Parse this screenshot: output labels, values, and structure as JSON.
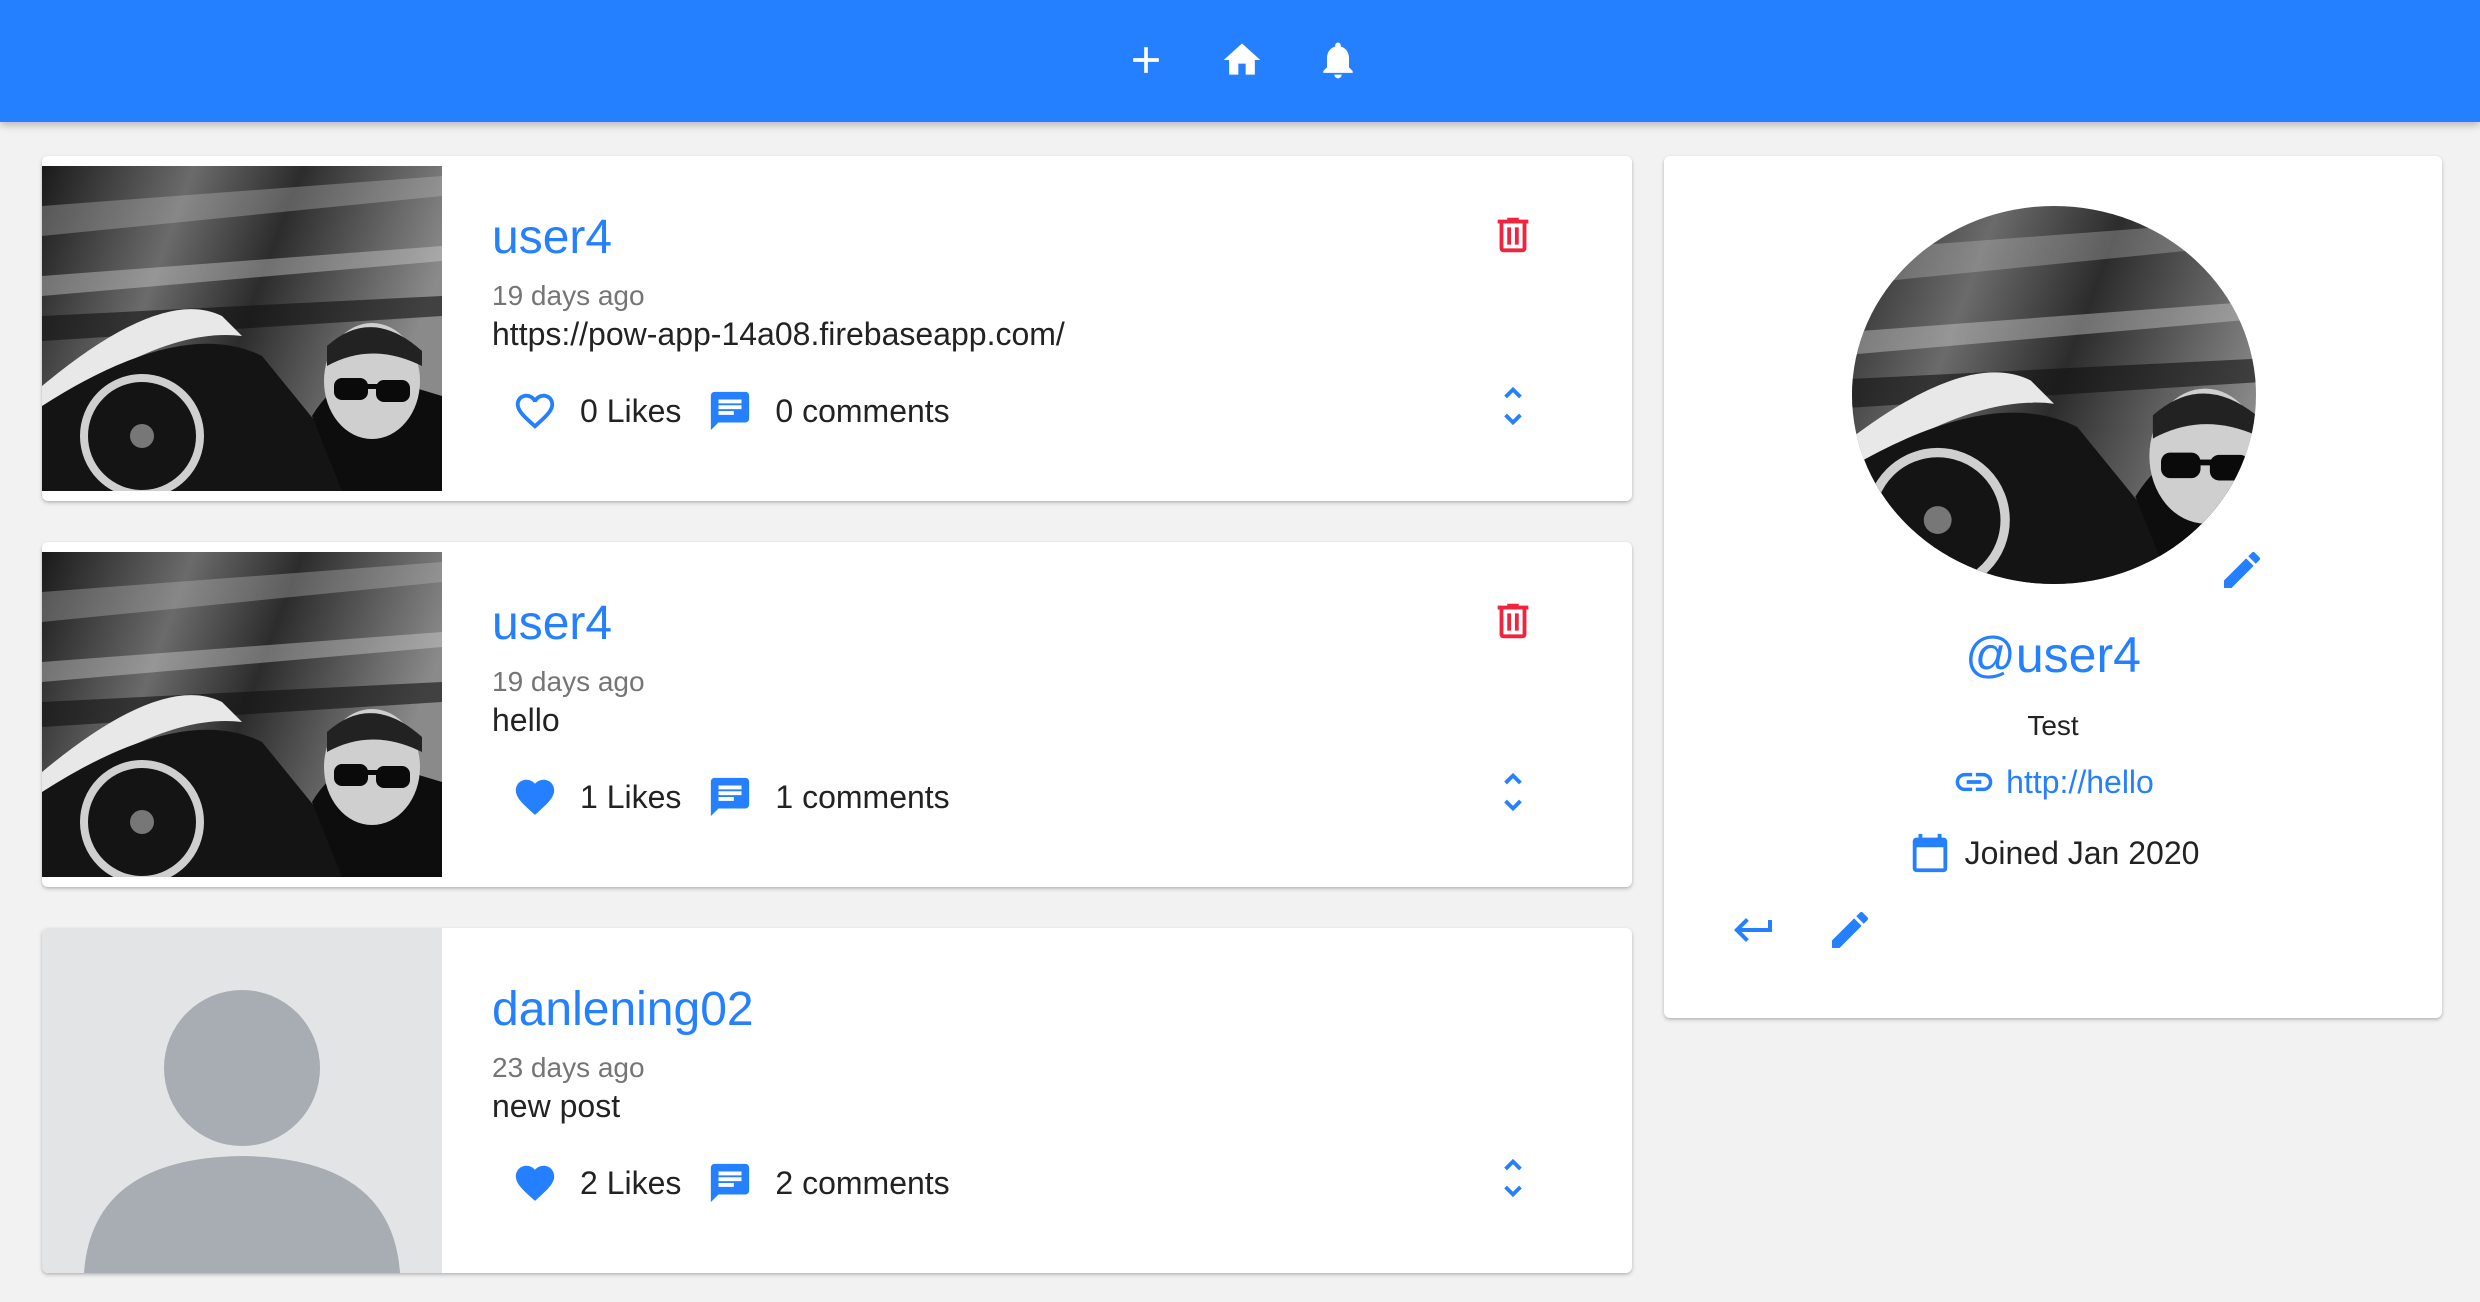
{
  "topbar": {
    "icons": [
      "add-icon",
      "home-icon",
      "notifications-icon"
    ],
    "color": "#2580ff"
  },
  "posts": [
    {
      "username": "user4",
      "time": "19 days ago",
      "body": "https://pow-app-14a08.firebaseapp.com/",
      "likes": "0 Likes",
      "comments": "0 comments",
      "liked": false,
      "image": "driver-photo",
      "deletable": true
    },
    {
      "username": "user4",
      "time": "19 days ago",
      "body": "hello",
      "likes": "1 Likes",
      "comments": "1 comments",
      "liked": true,
      "image": "driver-photo",
      "deletable": true
    },
    {
      "username": "danlening02",
      "time": "23 days ago",
      "body": "new post",
      "likes": "2 Likes",
      "comments": "2 comments",
      "liked": true,
      "image": "default-avatar",
      "deletable": false
    }
  ],
  "profile": {
    "handle": "@user4",
    "bio": "Test",
    "website": "http://hello",
    "joined": "Joined Jan 2020"
  },
  "colors": {
    "accent": "#2580ff",
    "danger": "#f0243f",
    "background": "#f2f2f2"
  }
}
